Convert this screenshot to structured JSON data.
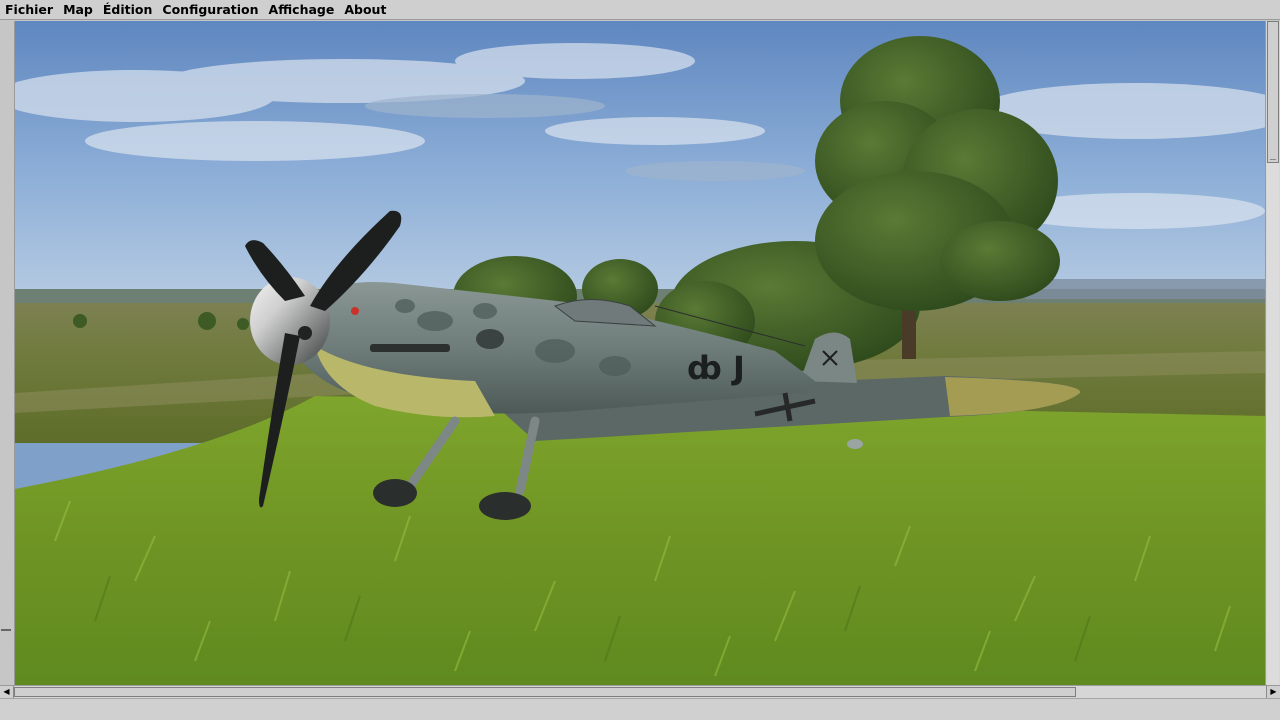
{
  "menubar": {
    "items": [
      {
        "label": "Fichier"
      },
      {
        "label": "Map"
      },
      {
        "label": "Édition"
      },
      {
        "label": "Configuration"
      },
      {
        "label": "Affichage"
      },
      {
        "label": "About"
      }
    ]
  },
  "viewport": {
    "scene": "3d-aircraft-view",
    "aircraft_markings": "ȸ J"
  },
  "scrollbars": {
    "vertical_position": 0,
    "horizontal_position": 0
  },
  "statusbar": {
    "text": ""
  },
  "colors": {
    "chrome": "#c6c6c6",
    "sky": "#7fa0c9",
    "grass": "#7c9a28"
  }
}
